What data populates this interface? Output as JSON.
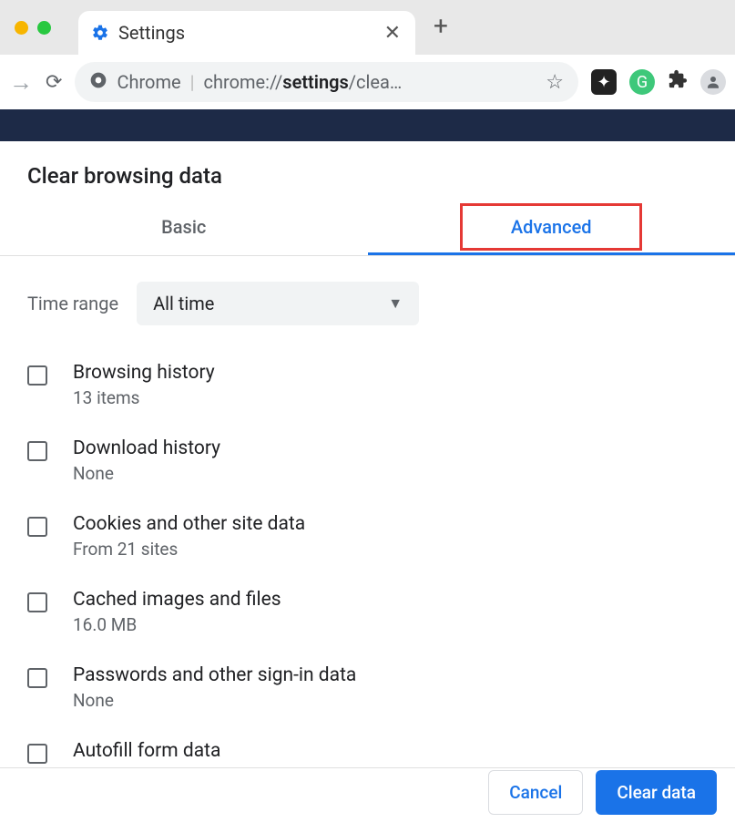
{
  "tab": {
    "title": "Settings"
  },
  "address": {
    "app_label": "Chrome",
    "url_display_prefix": "chrome://",
    "url_display_bold": "settings",
    "url_display_suffix": "/clea…"
  },
  "dialog": {
    "title": "Clear browsing data",
    "tabs": {
      "basic": "Basic",
      "advanced": "Advanced"
    },
    "time_range_label": "Time range",
    "time_range_value": "All time",
    "options": [
      {
        "title": "Browsing history",
        "sub": "13 items"
      },
      {
        "title": "Download history",
        "sub": "None"
      },
      {
        "title": "Cookies and other site data",
        "sub": "From 21 sites"
      },
      {
        "title": "Cached images and files",
        "sub": "16.0 MB"
      },
      {
        "title": "Passwords and other sign-in data",
        "sub": "None"
      },
      {
        "title": "Autofill form data",
        "sub": ""
      }
    ],
    "buttons": {
      "cancel": "Cancel",
      "confirm": "Clear data"
    }
  }
}
